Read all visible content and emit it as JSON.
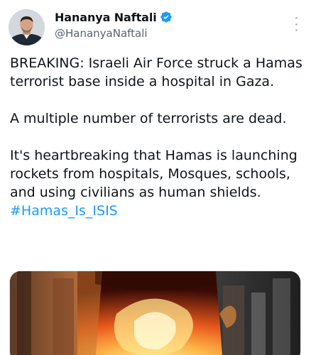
{
  "tweet": {
    "author": {
      "display_name": "Hananya Naftali",
      "handle": "@HananyaNaftali",
      "verified_color": "#1d9bf0"
    },
    "icons": {
      "verified": "verified-badge-icon",
      "more": "more-options-icon"
    },
    "body": {
      "paragraph_1": "BREAKING: Israeli Air Force struck a Hamas terrorist base inside a hospital in Gaza.",
      "paragraph_2": "A multiple number of terrorists are dead.",
      "paragraph_3": "It's heartbreaking that Hamas is launching rockets from hospitals, Mosques, schools, and using civilians as human shields. ",
      "hashtag": "#Hamas_Is_ISIS"
    },
    "colors": {
      "hashtag": "#1d9bf0",
      "secondary_text": "#536471"
    }
  }
}
